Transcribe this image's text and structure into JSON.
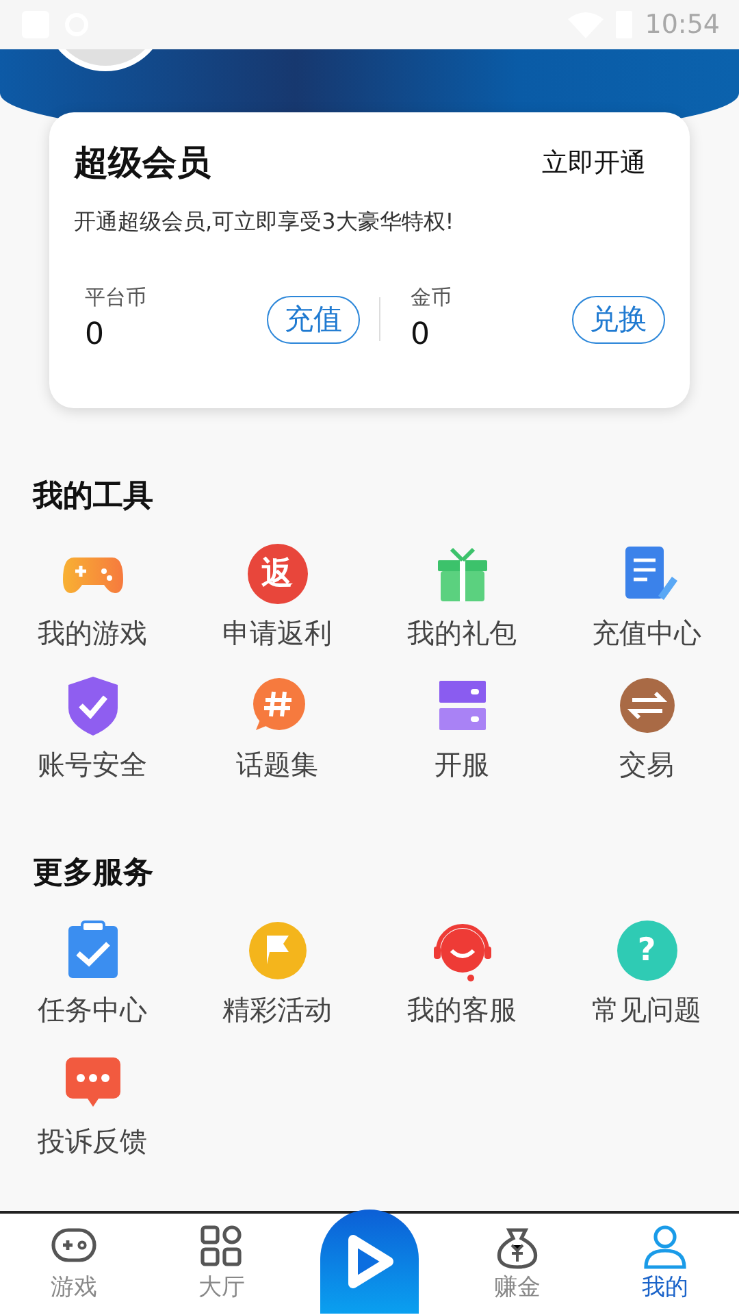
{
  "status_bar": {
    "time": "10:54"
  },
  "member_card": {
    "title": "超级会员",
    "action": "立即开通",
    "description": "开通超级会员,可立即享受3大豪华特权!",
    "balances": [
      {
        "label": "平台币",
        "value": "0",
        "button": "充值"
      },
      {
        "label": "金币",
        "value": "0",
        "button": "兑换"
      }
    ]
  },
  "sections": [
    {
      "title": "我的工具",
      "items": [
        {
          "label": "我的游戏"
        },
        {
          "label": "申请返利",
          "glyph": "返"
        },
        {
          "label": "我的礼包"
        },
        {
          "label": "充值中心"
        },
        {
          "label": "账号安全"
        },
        {
          "label": "话题集"
        },
        {
          "label": "开服"
        },
        {
          "label": "交易"
        }
      ]
    },
    {
      "title": "更多服务",
      "items": [
        {
          "label": "任务中心"
        },
        {
          "label": "精彩活动"
        },
        {
          "label": "我的客服"
        },
        {
          "label": "常见问题",
          "glyph": "?"
        },
        {
          "label": "投诉反馈"
        }
      ]
    }
  ],
  "bottom_nav": [
    {
      "label": "游戏",
      "selected": false
    },
    {
      "label": "大厅",
      "selected": false
    },
    {
      "kind": "center"
    },
    {
      "label": "赚金",
      "selected": false
    },
    {
      "label": "我的",
      "selected": true
    }
  ]
}
